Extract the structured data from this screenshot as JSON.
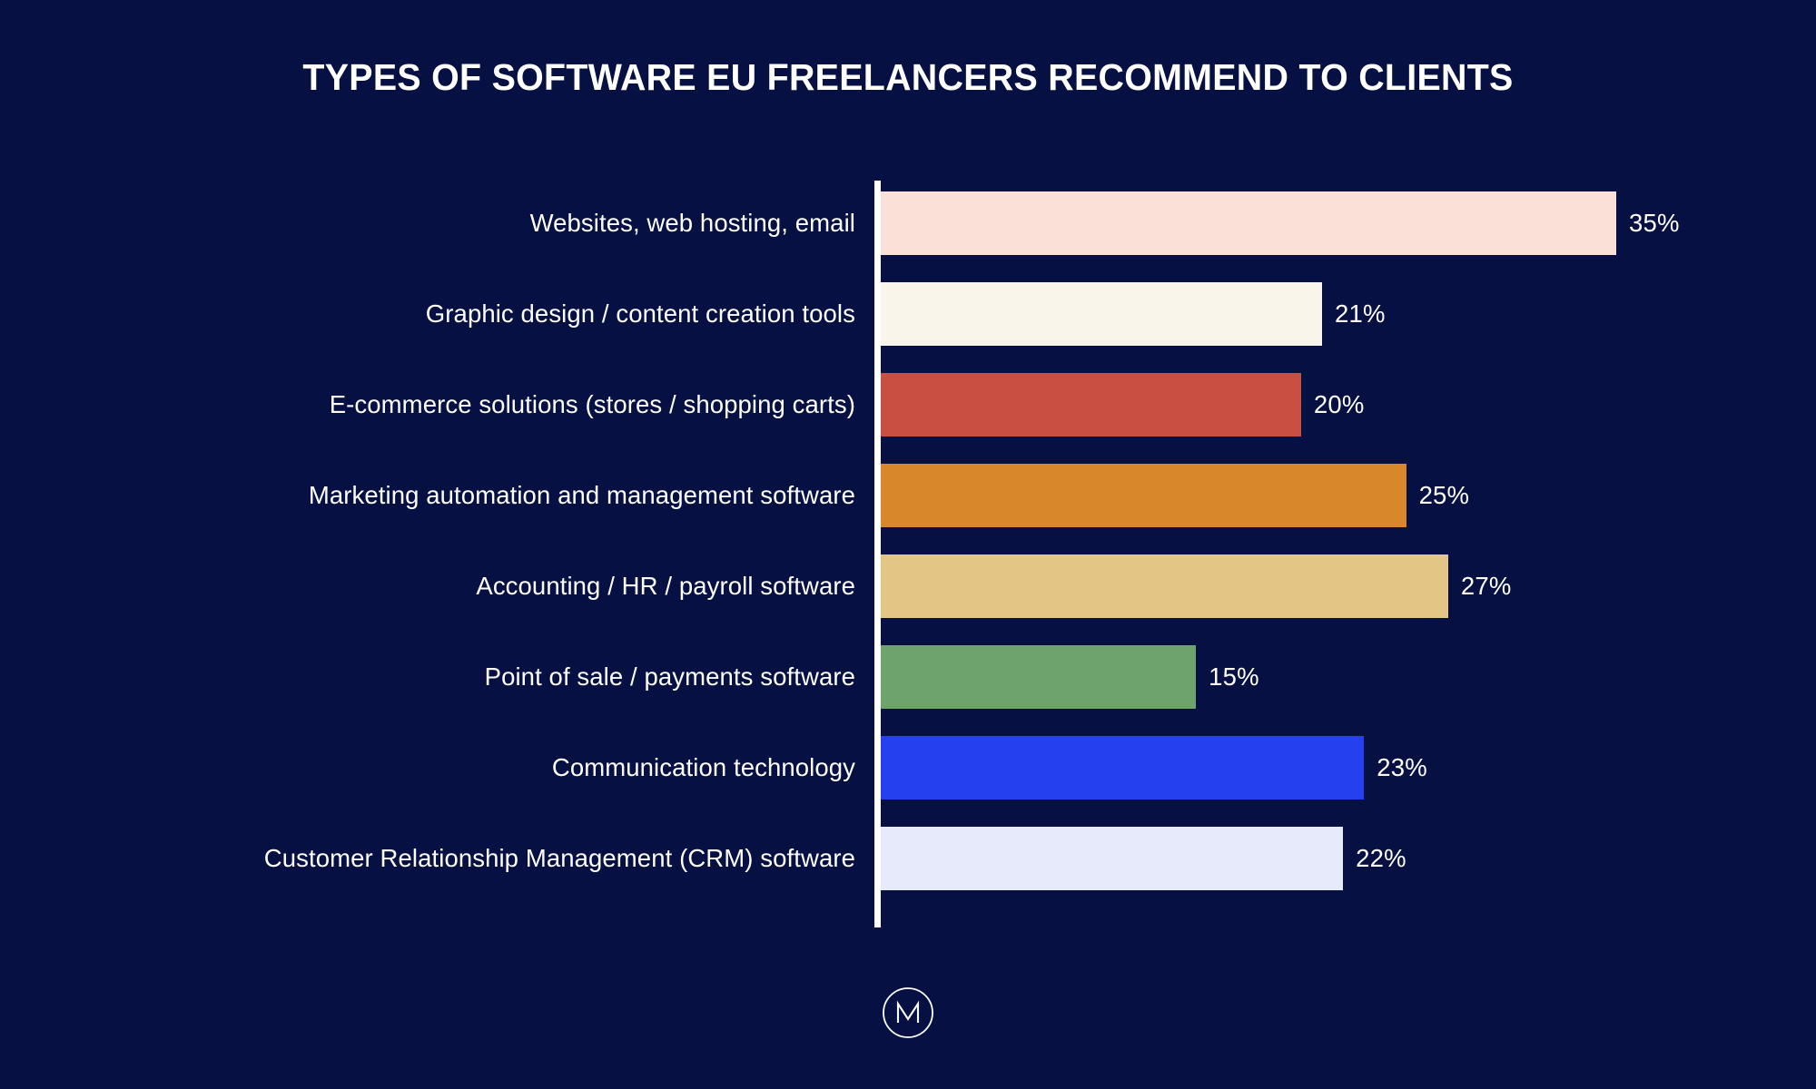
{
  "chart_data": {
    "type": "bar",
    "orientation": "horizontal",
    "title": "TYPES OF SOFTWARE EU FREELANCERS RECOMMEND TO CLIENTS",
    "xlabel": "",
    "ylabel": "",
    "xlim": [
      0,
      35
    ],
    "grid": false,
    "legend": "none",
    "value_suffix": "%",
    "categories": [
      "Websites, web hosting, email",
      "Graphic design / content creation tools",
      "E-commerce solutions (stores / shopping carts)",
      "Marketing automation and management software",
      "Accounting / HR / payroll software",
      "Point of sale / payments software",
      "Communication technology",
      "Customer Relationship Management (CRM) software"
    ],
    "values": [
      35,
      21,
      20,
      25,
      27,
      15,
      23,
      22
    ],
    "value_labels": [
      "35%",
      "21%",
      "20%",
      "25%",
      "27%",
      "15%",
      "23%",
      "22%"
    ],
    "bar_colors": [
      "#fbe0d8",
      "#faf5ea",
      "#ca4f43",
      "#d9872b",
      "#e3c585",
      "#6da36d",
      "#2440ef",
      "#e7eafa"
    ]
  },
  "colors": {
    "background": "#061042",
    "text": "#ffffff",
    "axis": "#ffffff"
  },
  "logo": {
    "icon": "monogram-m-circle-logo"
  }
}
